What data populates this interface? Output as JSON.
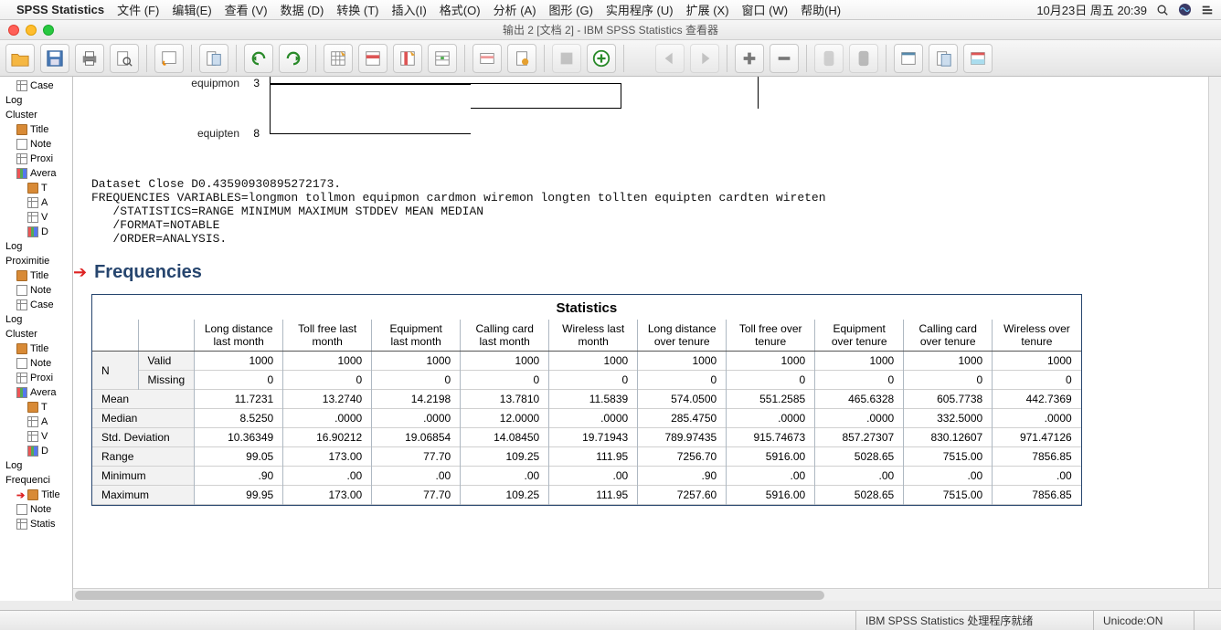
{
  "menubar": {
    "appname": "SPSS Statistics",
    "menus": [
      "文件 (F)",
      "编辑(E)",
      "查看 (V)",
      "数据 (D)",
      "转换 (T)",
      "插入(I)",
      "格式(O)",
      "分析 (A)",
      "图形 (G)",
      "实用程序 (U)",
      "扩展 (X)",
      "窗口 (W)",
      "帮助(H)"
    ],
    "clock": "10月23日 周五  20:39"
  },
  "window": {
    "title": "输出 2 [文档 2] - IBM SPSS Statistics 查看器"
  },
  "outline": [
    {
      "lvl": 2,
      "icon": "table",
      "label": "Case"
    },
    {
      "lvl": 1,
      "icon": "",
      "label": "Log"
    },
    {
      "lvl": 1,
      "icon": "",
      "label": "Cluster"
    },
    {
      "lvl": 2,
      "icon": "book",
      "label": "Title"
    },
    {
      "lvl": 2,
      "icon": "note",
      "label": "Note"
    },
    {
      "lvl": 2,
      "icon": "table",
      "label": "Proxi"
    },
    {
      "lvl": 2,
      "icon": "chart",
      "label": "Avera"
    },
    {
      "lvl": 3,
      "icon": "book",
      "label": "T"
    },
    {
      "lvl": 3,
      "icon": "table",
      "label": "A"
    },
    {
      "lvl": 3,
      "icon": "table",
      "label": "V"
    },
    {
      "lvl": 3,
      "icon": "chart",
      "label": "D"
    },
    {
      "lvl": 1,
      "icon": "",
      "label": "Log"
    },
    {
      "lvl": 1,
      "icon": "",
      "label": "Proximitie"
    },
    {
      "lvl": 2,
      "icon": "book",
      "label": "Title"
    },
    {
      "lvl": 2,
      "icon": "note",
      "label": "Note"
    },
    {
      "lvl": 2,
      "icon": "table",
      "label": "Case"
    },
    {
      "lvl": 1,
      "icon": "",
      "label": "Log"
    },
    {
      "lvl": 1,
      "icon": "",
      "label": "Cluster"
    },
    {
      "lvl": 2,
      "icon": "book",
      "label": "Title"
    },
    {
      "lvl": 2,
      "icon": "note",
      "label": "Note"
    },
    {
      "lvl": 2,
      "icon": "table",
      "label": "Proxi"
    },
    {
      "lvl": 2,
      "icon": "chart",
      "label": "Avera"
    },
    {
      "lvl": 3,
      "icon": "book",
      "label": "T"
    },
    {
      "lvl": 3,
      "icon": "table",
      "label": "A"
    },
    {
      "lvl": 3,
      "icon": "table",
      "label": "V"
    },
    {
      "lvl": 3,
      "icon": "chart",
      "label": "D"
    },
    {
      "lvl": 1,
      "icon": "",
      "label": "Log"
    },
    {
      "lvl": 1,
      "icon": "",
      "label": "Frequenci"
    },
    {
      "lvl": 2,
      "icon": "book",
      "label": "Title",
      "active": true
    },
    {
      "lvl": 2,
      "icon": "note",
      "label": "Note"
    },
    {
      "lvl": 2,
      "icon": "table",
      "label": "Statis"
    }
  ],
  "dendro": [
    {
      "label": "equipmon",
      "num": "3"
    },
    {
      "label": "equipten",
      "num": "8"
    }
  ],
  "syntax": "Dataset Close D0.43590930895272173.\nFREQUENCIES VARIABLES=longmon tollmon equipmon cardmon wiremon longten tollten equipten cardten wireten\n   /STATISTICS=RANGE MINIMUM MAXIMUM STDDEV MEAN MEDIAN\n   /FORMAT=NOTABLE\n   /ORDER=ANALYSIS.",
  "freq_heading": "Frequencies",
  "stats": {
    "title": "Statistics",
    "columns": [
      "Long distance last month",
      "Toll free last month",
      "Equipment last month",
      "Calling card last month",
      "Wireless last month",
      "Long distance over tenure",
      "Toll free over tenure",
      "Equipment over tenure",
      "Calling card over tenure",
      "Wireless over tenure"
    ],
    "nlabel": "N",
    "rows": [
      {
        "label": "Valid",
        "sub": true,
        "vals": [
          "1000",
          "1000",
          "1000",
          "1000",
          "1000",
          "1000",
          "1000",
          "1000",
          "1000",
          "1000"
        ]
      },
      {
        "label": "Missing",
        "sub": true,
        "vals": [
          "0",
          "0",
          "0",
          "0",
          "0",
          "0",
          "0",
          "0",
          "0",
          "0"
        ]
      },
      {
        "label": "Mean",
        "vals": [
          "11.7231",
          "13.2740",
          "14.2198",
          "13.7810",
          "11.5839",
          "574.0500",
          "551.2585",
          "465.6328",
          "605.7738",
          "442.7369"
        ]
      },
      {
        "label": "Median",
        "vals": [
          "8.5250",
          ".0000",
          ".0000",
          "12.0000",
          ".0000",
          "285.4750",
          ".0000",
          ".0000",
          "332.5000",
          ".0000"
        ]
      },
      {
        "label": "Std. Deviation",
        "vals": [
          "10.36349",
          "16.90212",
          "19.06854",
          "14.08450",
          "19.71943",
          "789.97435",
          "915.74673",
          "857.27307",
          "830.12607",
          "971.47126"
        ]
      },
      {
        "label": "Range",
        "vals": [
          "99.05",
          "173.00",
          "77.70",
          "109.25",
          "111.95",
          "7256.70",
          "5916.00",
          "5028.65",
          "7515.00",
          "7856.85"
        ]
      },
      {
        "label": "Minimum",
        "vals": [
          ".90",
          ".00",
          ".00",
          ".00",
          ".00",
          ".90",
          ".00",
          ".00",
          ".00",
          ".00"
        ]
      },
      {
        "label": "Maximum",
        "vals": [
          "99.95",
          "173.00",
          "77.70",
          "109.25",
          "111.95",
          "7257.60",
          "5916.00",
          "5028.65",
          "7515.00",
          "7856.85"
        ]
      }
    ]
  },
  "status": {
    "proc": "IBM SPSS Statistics 处理程序就绪",
    "unicode": "Unicode:ON"
  },
  "chart_data": {
    "type": "table",
    "title": "Statistics",
    "columns": [
      "Long distance last month",
      "Toll free last month",
      "Equipment last month",
      "Calling card last month",
      "Wireless last month",
      "Long distance over tenure",
      "Toll free over tenure",
      "Equipment over tenure",
      "Calling card over tenure",
      "Wireless over tenure"
    ],
    "rows": {
      "N Valid": [
        1000,
        1000,
        1000,
        1000,
        1000,
        1000,
        1000,
        1000,
        1000,
        1000
      ],
      "N Missing": [
        0,
        0,
        0,
        0,
        0,
        0,
        0,
        0,
        0,
        0
      ],
      "Mean": [
        11.7231,
        13.274,
        14.2198,
        13.781,
        11.5839,
        574.05,
        551.2585,
        465.6328,
        605.7738,
        442.7369
      ],
      "Median": [
        8.525,
        0.0,
        0.0,
        12.0,
        0.0,
        285.475,
        0.0,
        0.0,
        332.5,
        0.0
      ],
      "Std. Deviation": [
        10.36349,
        16.90212,
        19.06854,
        14.0845,
        19.71943,
        789.97435,
        915.74673,
        857.27307,
        830.12607,
        971.47126
      ],
      "Range": [
        99.05,
        173.0,
        77.7,
        109.25,
        111.95,
        7256.7,
        5916.0,
        5028.65,
        7515.0,
        7856.85
      ],
      "Minimum": [
        0.9,
        0.0,
        0.0,
        0.0,
        0.0,
        0.9,
        0.0,
        0.0,
        0.0,
        0.0
      ],
      "Maximum": [
        99.95,
        173.0,
        77.7,
        109.25,
        111.95,
        7257.6,
        5916.0,
        5028.65,
        7515.0,
        7856.85
      ]
    }
  }
}
